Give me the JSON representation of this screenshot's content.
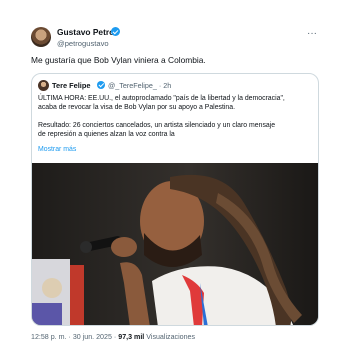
{
  "tweet": {
    "author": {
      "name": "Gustavo Petro",
      "handle": "@petrogustavo"
    },
    "more": "···",
    "text": "Me gustaría que Bob Vylan viniera a Colombia.",
    "quote": {
      "author": {
        "name": "Tere Felipe",
        "handle": "@_TereFelipe_",
        "time": "· 2h"
      },
      "lines": [
        "ÚLTIMA HORA: EE.UU., el autoproclamado \"país de la libertad y la democracia\",",
        "acaba de revocar la visa de Bob Vylan por su apoyo a Palestina.",
        "Resultado: 26 conciertos cancelados,  un artista silenciado y un claro mensaje",
        "de represión a quienes alzan la voz contra la"
      ],
      "show_more": "Mostrar más"
    },
    "meta": {
      "time": "12:58 p. m.",
      "sep1": "·",
      "date": "30 jun. 2025",
      "sep2": "·",
      "views_count": "97,3 mil",
      "views_label": "Visualizaciones"
    }
  },
  "colors": {
    "link": "#1d9bf0",
    "verified": "#1d9bf0",
    "muted": "#536471",
    "text": "#0f1419",
    "border": "#cfd9de"
  }
}
